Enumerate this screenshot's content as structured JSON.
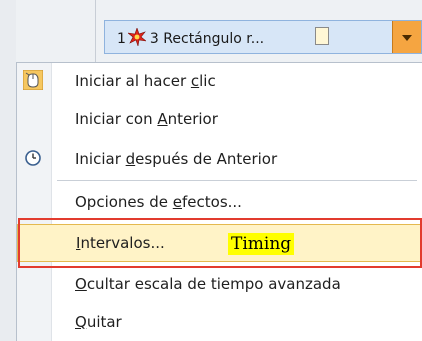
{
  "anim_row": {
    "order": "1",
    "effect_icon": "starburst-icon",
    "label": "3 Rectángulo r...",
    "dropdown_icon": "dropdown-arrow-icon"
  },
  "menu": {
    "items": [
      {
        "pre": "Iniciar al hacer ",
        "u": "c",
        "post": "lic",
        "icon": "mouse-click-icon"
      },
      {
        "pre": "Iniciar con ",
        "u": "A",
        "post": "nterior"
      },
      {
        "pre": "Iniciar ",
        "u": "d",
        "post": "espués de Anterior",
        "icon": "clock-icon"
      },
      {
        "pre": "Opciones de ",
        "u": "e",
        "post": "fectos..."
      },
      {
        "pre": "",
        "u": "I",
        "post": "ntervalos..."
      },
      {
        "pre": "",
        "u": "O",
        "post": "cultar escala de tiempo avanzada"
      },
      {
        "pre": "",
        "u": "Q",
        "post": "uitar"
      }
    ]
  },
  "annotation": {
    "text": "Timing",
    "color": "#ffff00",
    "frame_color": "#e23b2e"
  },
  "colors": {
    "highlight": "#fff3c7",
    "dropdown": "#f5a541",
    "selection": "#d7e6f7"
  }
}
